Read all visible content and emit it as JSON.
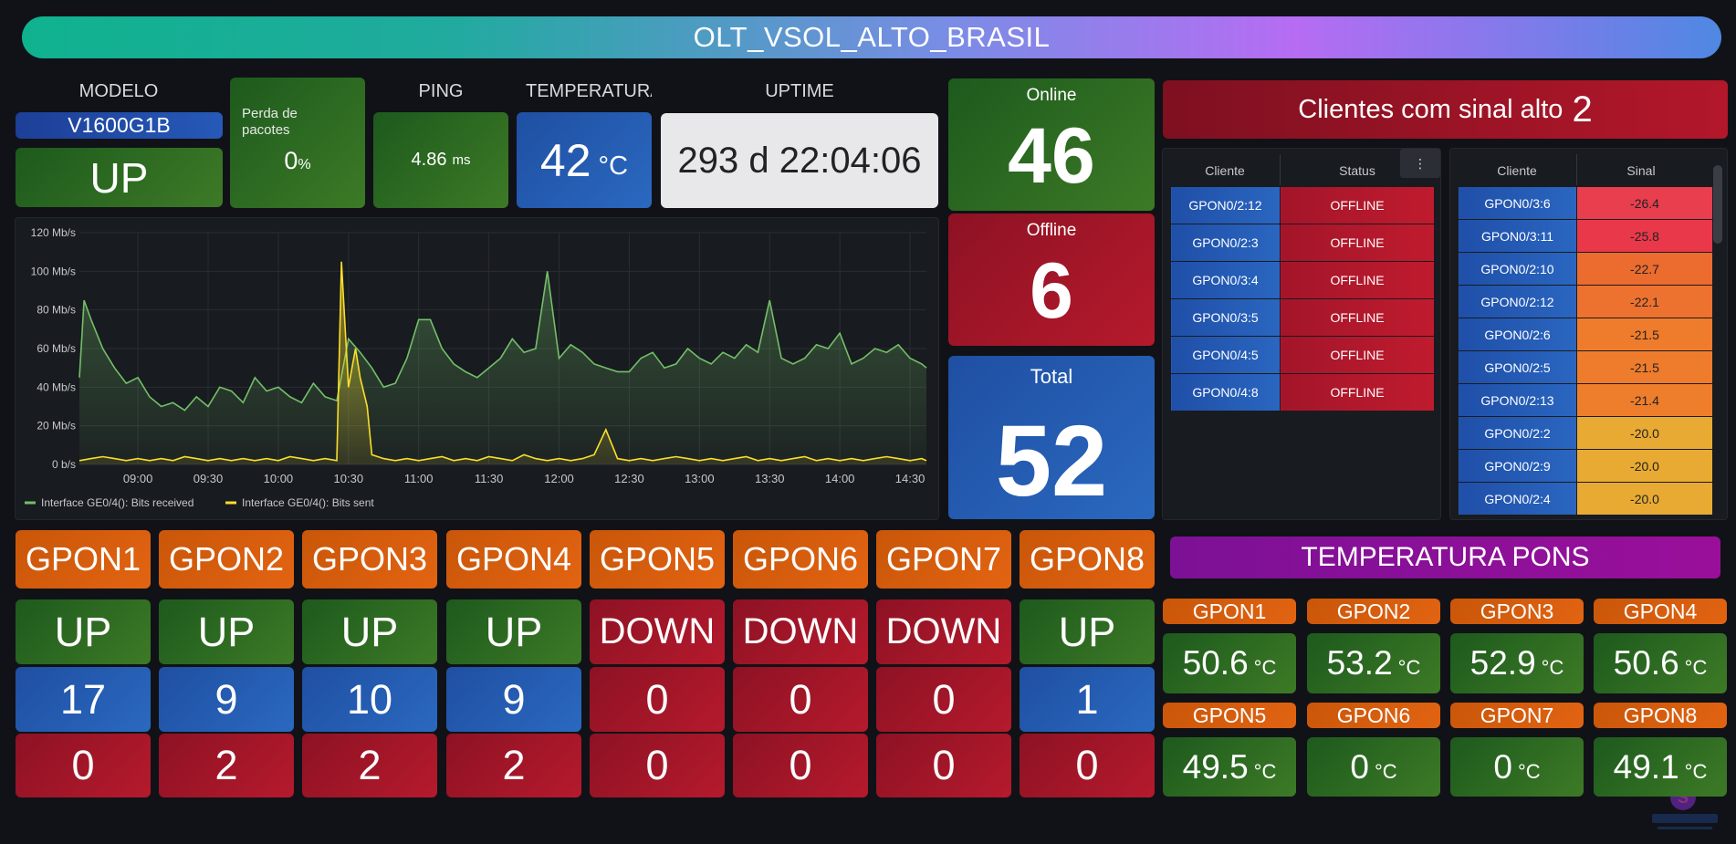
{
  "header": {
    "title": "OLT_VSOL_ALTO_BRASIL"
  },
  "stats": {
    "modelo_label": "MODELO",
    "modelo_value": "V1600G1B",
    "status": "UP",
    "perda_label": "Perda de pacotes",
    "perda_value": "0",
    "perda_unit": "%",
    "ping_label": "PING",
    "ping_value": "4.86",
    "ping_unit": "ms",
    "temp_label": "TEMPERATURA",
    "temp_value": "42",
    "temp_unit": "°C",
    "uptime_label": "UPTIME",
    "uptime_value": "293 d 22:04:06"
  },
  "totals": {
    "online_label": "Online",
    "online_value": "46",
    "offline_label": "Offline",
    "offline_value": "6",
    "total_label": "Total",
    "total_value": "52"
  },
  "chart_data": {
    "type": "line",
    "ylim": [
      0,
      120
    ],
    "y_ticks": [
      "0 b/s",
      "20 Mb/s",
      "40 Mb/s",
      "60 Mb/s",
      "80 Mb/s",
      "100 Mb/s",
      "120 Mb/s"
    ],
    "x_ticks": [
      "09:00",
      "09:30",
      "10:00",
      "10:30",
      "11:00",
      "11:30",
      "12:00",
      "12:30",
      "13:00",
      "13:30",
      "14:00",
      "14:30"
    ],
    "x_range": [
      "08:35",
      "14:37"
    ],
    "series": [
      {
        "name": "Interface GE0/4(): Bits received",
        "color": "#73bf69",
        "x": [
          "08:35",
          "08:37",
          "08:40",
          "08:45",
          "08:50",
          "08:55",
          "09:00",
          "09:05",
          "09:10",
          "09:15",
          "09:20",
          "09:25",
          "09:30",
          "09:35",
          "09:40",
          "09:45",
          "09:50",
          "09:55",
          "10:00",
          "10:05",
          "10:10",
          "10:15",
          "10:20",
          "10:25",
          "10:30",
          "10:35",
          "10:40",
          "10:45",
          "10:50",
          "10:55",
          "11:00",
          "11:05",
          "11:10",
          "11:15",
          "11:20",
          "11:25",
          "11:30",
          "11:35",
          "11:40",
          "11:45",
          "11:50",
          "11:55",
          "12:00",
          "12:05",
          "12:10",
          "12:15",
          "12:20",
          "12:25",
          "12:30",
          "12:35",
          "12:40",
          "12:45",
          "12:50",
          "12:55",
          "13:00",
          "13:05",
          "13:10",
          "13:15",
          "13:20",
          "13:25",
          "13:30",
          "13:35",
          "13:40",
          "13:45",
          "13:50",
          "13:55",
          "14:00",
          "14:05",
          "14:10",
          "14:15",
          "14:20",
          "14:25",
          "14:30",
          "14:35",
          "14:37"
        ],
        "y": [
          45,
          85,
          75,
          60,
          50,
          42,
          45,
          35,
          30,
          32,
          28,
          35,
          30,
          40,
          38,
          32,
          45,
          38,
          40,
          35,
          32,
          42,
          35,
          33,
          65,
          58,
          50,
          40,
          42,
          55,
          75,
          75,
          60,
          52,
          48,
          45,
          50,
          55,
          65,
          58,
          60,
          100,
          55,
          62,
          58,
          52,
          50,
          48,
          48,
          55,
          58,
          50,
          52,
          60,
          55,
          52,
          58,
          55,
          62,
          58,
          85,
          55,
          52,
          55,
          62,
          60,
          68,
          52,
          55,
          60,
          58,
          62,
          55,
          52,
          50
        ]
      },
      {
        "name": "Interface GE0/4(): Bits sent",
        "color": "#fade2a",
        "x": [
          "08:35",
          "08:40",
          "08:45",
          "08:50",
          "08:55",
          "09:00",
          "09:05",
          "09:10",
          "09:15",
          "09:20",
          "09:25",
          "09:30",
          "09:35",
          "09:40",
          "09:45",
          "09:50",
          "09:55",
          "10:00",
          "10:05",
          "10:10",
          "10:15",
          "10:20",
          "10:25",
          "10:27",
          "10:30",
          "10:33",
          "10:35",
          "10:38",
          "10:40",
          "10:45",
          "10:50",
          "10:55",
          "11:00",
          "11:05",
          "11:10",
          "11:15",
          "11:20",
          "11:25",
          "11:30",
          "11:35",
          "11:40",
          "11:45",
          "11:50",
          "11:55",
          "12:00",
          "12:05",
          "12:10",
          "12:15",
          "12:20",
          "12:25",
          "12:30",
          "12:35",
          "12:40",
          "12:45",
          "12:50",
          "12:55",
          "13:00",
          "13:05",
          "13:10",
          "13:15",
          "13:20",
          "13:25",
          "13:30",
          "13:35",
          "13:40",
          "13:45",
          "13:50",
          "13:55",
          "14:00",
          "14:05",
          "14:10",
          "14:15",
          "14:20",
          "14:25",
          "14:30",
          "14:35",
          "14:37"
        ],
        "y": [
          2,
          3,
          4,
          3,
          2,
          3,
          2,
          3,
          2,
          4,
          3,
          2,
          3,
          2,
          3,
          2,
          3,
          2,
          4,
          3,
          2,
          3,
          2,
          105,
          40,
          60,
          45,
          30,
          5,
          3,
          2,
          3,
          2,
          3,
          4,
          2,
          3,
          2,
          4,
          3,
          2,
          5,
          3,
          2,
          3,
          2,
          3,
          5,
          18,
          3,
          2,
          3,
          2,
          3,
          4,
          3,
          2,
          3,
          2,
          3,
          4,
          2,
          3,
          2,
          3,
          4,
          2,
          3,
          2,
          3,
          2,
          3,
          4,
          3,
          2,
          3,
          2
        ]
      }
    ],
    "legend_position": "bottom-left"
  },
  "clients_offline": {
    "col_cliente": "Cliente",
    "col_status": "Status",
    "rows": [
      {
        "cliente": "GPON0/2:12",
        "status": "OFFLINE"
      },
      {
        "cliente": "GPON0/2:3",
        "status": "OFFLINE"
      },
      {
        "cliente": "GPON0/3:4",
        "status": "OFFLINE"
      },
      {
        "cliente": "GPON0/3:5",
        "status": "OFFLINE"
      },
      {
        "cliente": "GPON0/4:5",
        "status": "OFFLINE"
      },
      {
        "cliente": "GPON0/4:8",
        "status": "OFFLINE"
      }
    ]
  },
  "sinal_alto": {
    "title": "Clientes com sinal alto",
    "count": "2",
    "col_cliente": "Cliente",
    "col_sinal": "Sinal",
    "rows": [
      {
        "cliente": "GPON0/3:6",
        "sinal": "-26.4",
        "color": "#e83e4e"
      },
      {
        "cliente": "GPON0/3:11",
        "sinal": "-25.8",
        "color": "#e8384a"
      },
      {
        "cliente": "GPON0/2:10",
        "sinal": "-22.7",
        "color": "#ec6b2e"
      },
      {
        "cliente": "GPON0/2:12",
        "sinal": "-22.1",
        "color": "#ed7230"
      },
      {
        "cliente": "GPON0/2:6",
        "sinal": "-21.5",
        "color": "#ef7c2c"
      },
      {
        "cliente": "GPON0/2:5",
        "sinal": "-21.5",
        "color": "#ef7c2c"
      },
      {
        "cliente": "GPON0/2:13",
        "sinal": "-21.4",
        "color": "#ef7e2c"
      },
      {
        "cliente": "GPON0/2:2",
        "sinal": "-20.0",
        "color": "#e8aa32"
      },
      {
        "cliente": "GPON0/2:9",
        "sinal": "-20.0",
        "color": "#e8aa32"
      },
      {
        "cliente": "GPON0/2:4",
        "sinal": "-20.0",
        "color": "#e8aa32"
      }
    ]
  },
  "gpons": [
    {
      "name": "GPON1",
      "status": "UP",
      "online": "17",
      "offline": "0"
    },
    {
      "name": "GPON2",
      "status": "UP",
      "online": "9",
      "offline": "2"
    },
    {
      "name": "GPON3",
      "status": "UP",
      "online": "10",
      "offline": "2"
    },
    {
      "name": "GPON4",
      "status": "UP",
      "online": "9",
      "offline": "2"
    },
    {
      "name": "GPON5",
      "status": "DOWN",
      "online": "0",
      "offline": "0"
    },
    {
      "name": "GPON6",
      "status": "DOWN",
      "online": "0",
      "offline": "0"
    },
    {
      "name": "GPON7",
      "status": "DOWN",
      "online": "0",
      "offline": "0"
    },
    {
      "name": "GPON8",
      "status": "UP",
      "online": "1",
      "offline": "0"
    }
  ],
  "temp_pons": {
    "title": "TEMPERATURA PONS",
    "unit": "°C",
    "items": [
      {
        "name": "GPON1",
        "value": "50.6"
      },
      {
        "name": "GPON2",
        "value": "53.2"
      },
      {
        "name": "GPON3",
        "value": "52.9"
      },
      {
        "name": "GPON4",
        "value": "50.6"
      },
      {
        "name": "GPON5",
        "value": "49.5"
      },
      {
        "name": "GPON6",
        "value": "0"
      },
      {
        "name": "GPON7",
        "value": "0"
      },
      {
        "name": "GPON8",
        "value": "49.1"
      }
    ]
  },
  "menu": {
    "icon": "kebab-menu-icon",
    "glyph": "⋮"
  }
}
